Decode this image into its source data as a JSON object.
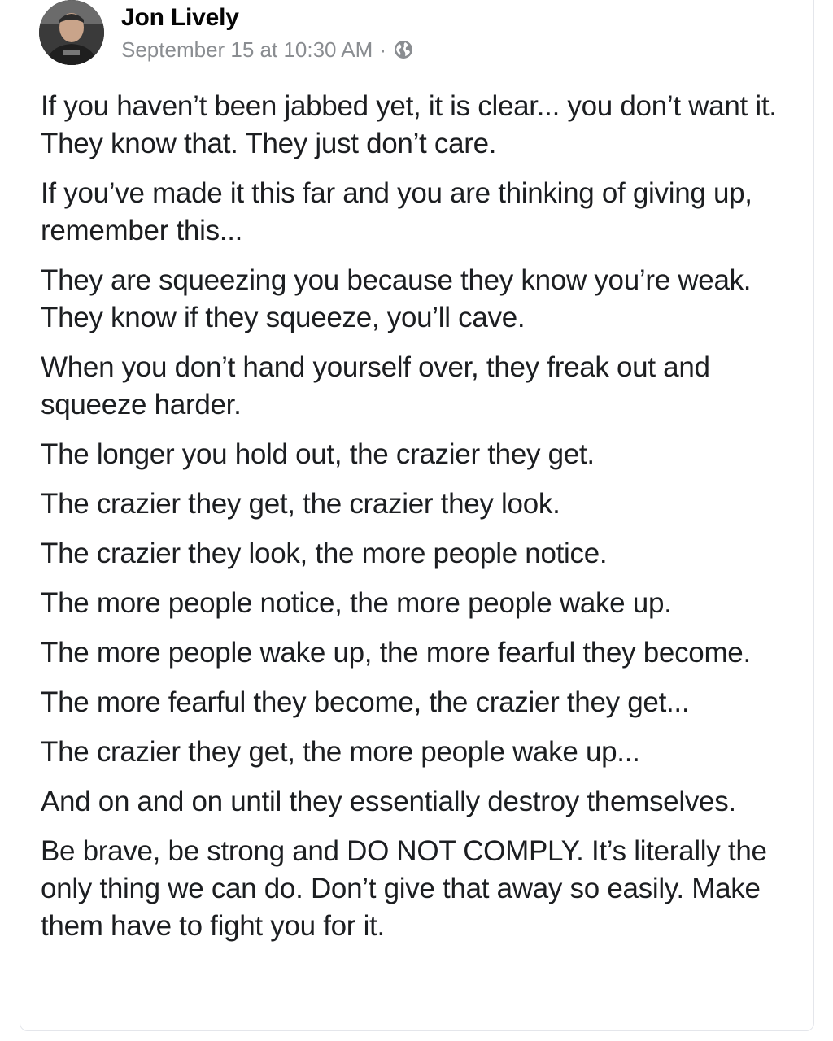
{
  "post": {
    "author": "Jon Lively",
    "timestamp": "September 15 at 10:30 AM",
    "separator": "·",
    "privacy_icon": "globe-icon",
    "paragraphs": [
      "If you haven’t been jabbed yet, it is clear... you don’t want it. They know that. They just don’t care.",
      "If you’ve made it this far and you are thinking of giving up, remember this...",
      "They are squeezing you because they know you’re weak. They know if they squeeze, you’ll cave.",
      "When you don’t hand yourself over, they freak out and squeeze harder.",
      "The longer you hold out, the crazier they get.",
      "The crazier they get, the crazier they look.",
      "The crazier they look, the more people notice.",
      "The more people notice, the more people wake up.",
      "The more people wake up, the more fearful they become.",
      "The more fearful they become, the crazier they get...",
      "The crazier they get, the more people wake up...",
      "And on and on until they essentially destroy themselves.",
      "Be brave, be strong and DO NOT COMPLY. It’s literally the only thing we can do. Don’t give that away so easily. Make them have to fight you for it."
    ]
  },
  "colors": {
    "text": "#1c1e21",
    "meta": "#8a8d91",
    "border": "#e4e6eb"
  }
}
